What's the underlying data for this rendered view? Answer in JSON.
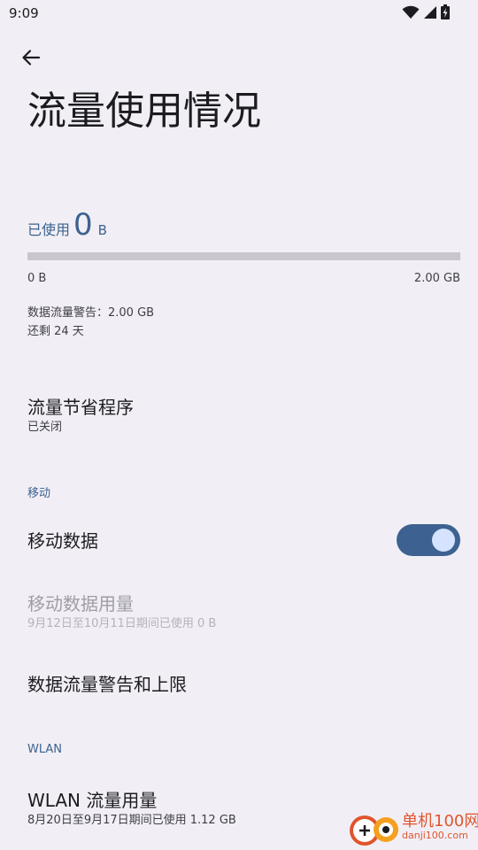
{
  "status_bar": {
    "time": "9:09",
    "icons": [
      "wifi-icon",
      "cell-signal-icon",
      "battery-charging-icon"
    ]
  },
  "app_bar": {
    "back_icon": "arrow-back-icon",
    "title": "流量使用情况"
  },
  "usage": {
    "label": "已使用",
    "value": "0",
    "unit": "B",
    "bar_fraction": 0,
    "bar_min_label": "0 B",
    "bar_max_label": "2.00 GB",
    "warning": "数据流量警告：2.00 GB",
    "remaining": "还剩 24 天"
  },
  "data_saver": {
    "title": "流量节省程序",
    "summary": "已关闭"
  },
  "mobile_section": {
    "header": "移动",
    "mobile_data": {
      "title": "移动数据",
      "enabled": true
    },
    "mobile_data_usage": {
      "title": "移动数据用量",
      "summary": "9月12日至10月11日期间已使用 0 B"
    },
    "warning_limit": {
      "title": "数据流量警告和上限"
    }
  },
  "wlan_section": {
    "header": "WLAN",
    "wlan_usage": {
      "title": "WLAN 流量用量",
      "summary": "8月20日至9月17日期间已使用 1.12 GB"
    }
  },
  "watermark": {
    "name": "单机100网",
    "url": "danji100.com"
  },
  "colors": {
    "background": "#f1eff5",
    "accent": "#3d6291",
    "toggle_knob": "#d5e3ff",
    "watermark": "#e0552d"
  }
}
